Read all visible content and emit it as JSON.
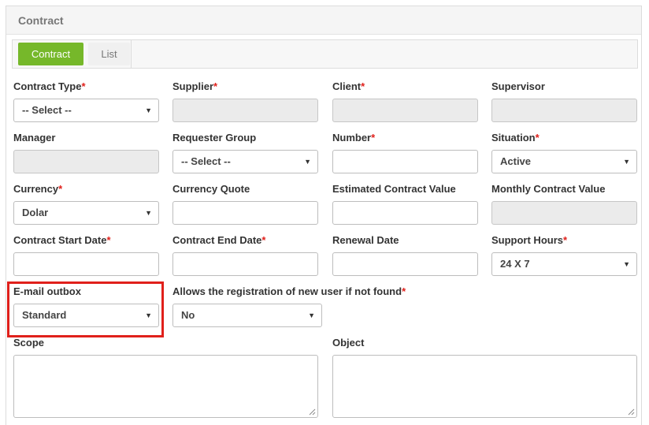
{
  "panel": {
    "title": "Contract"
  },
  "tabs": {
    "active_label": "Contract",
    "list_label": "List"
  },
  "fields": {
    "contract_type": {
      "label": "Contract Type",
      "required": "*",
      "value": "-- Select --"
    },
    "supplier": {
      "label": "Supplier",
      "required": "*"
    },
    "client": {
      "label": "Client",
      "required": "*"
    },
    "supervisor": {
      "label": "Supervisor"
    },
    "manager": {
      "label": "Manager"
    },
    "requester_group": {
      "label": "Requester Group",
      "value": "-- Select --"
    },
    "number": {
      "label": "Number",
      "required": "*"
    },
    "situation": {
      "label": "Situation",
      "required": "*",
      "value": "Active"
    },
    "currency": {
      "label": "Currency",
      "required": "*",
      "value": "Dolar"
    },
    "currency_quote": {
      "label": "Currency Quote"
    },
    "estimated_value": {
      "label": "Estimated Contract Value"
    },
    "monthly_value": {
      "label": "Monthly Contract Value"
    },
    "start_date": {
      "label": "Contract Start Date",
      "required": "*"
    },
    "end_date": {
      "label": "Contract End Date",
      "required": "*"
    },
    "renewal_date": {
      "label": "Renewal Date"
    },
    "support_hours": {
      "label": "Support Hours",
      "required": "*",
      "value": "24 X 7"
    },
    "email_outbox": {
      "label": "E-mail outbox",
      "value": "Standard"
    },
    "allow_registration": {
      "label": "Allows the registration of new user if not found",
      "required": "*",
      "value": "No"
    },
    "scope": {
      "label": "Scope"
    },
    "object": {
      "label": "Object"
    }
  },
  "icons": {
    "caret": "▼"
  },
  "colors": {
    "accent": "#76b82a",
    "required": "#e0201b",
    "highlight": "#e0201b",
    "disabled": "#ebebeb"
  }
}
